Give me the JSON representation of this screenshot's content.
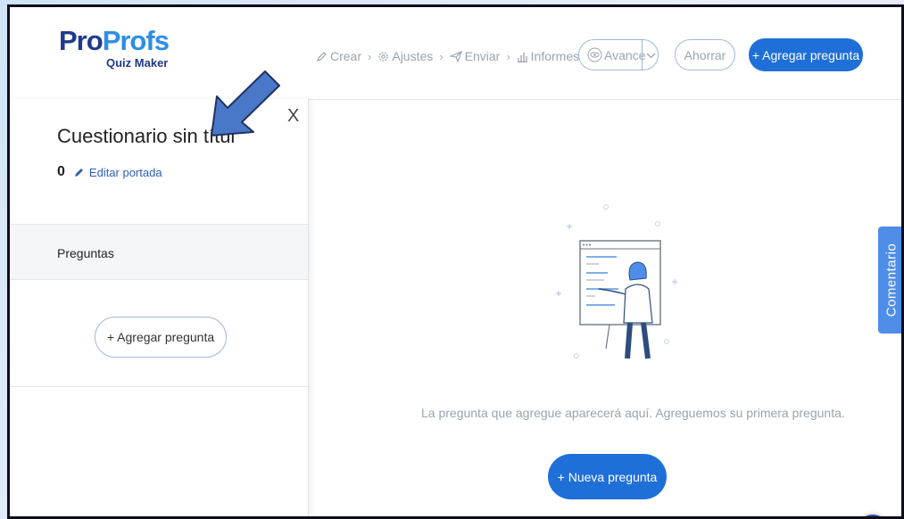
{
  "app": {
    "logo_main_1": "Pro",
    "logo_main_2": "Profs",
    "logo_sub": "Quiz Maker"
  },
  "steps": [
    {
      "label": "Crear",
      "icon": "pencil-icon"
    },
    {
      "label": "Ajustes",
      "icon": "gear-icon"
    },
    {
      "label": "Enviar",
      "icon": "paper-plane-icon"
    },
    {
      "label": "Informes",
      "icon": "bar-chart-icon"
    }
  ],
  "header": {
    "preview_label": "Avance",
    "save_label": "Ahorrar",
    "add_question_label": "+ Agregar pregunta"
  },
  "sidebar": {
    "close_label": "X",
    "quiz_title": "Cuestionario sin títul",
    "cover_count": "0",
    "edit_cover_label": "Editar portada",
    "section_label": "Preguntas",
    "add_question_label": "+ Agregar pregunta"
  },
  "main": {
    "empty_message": "La pregunta que agregue aparecerá aquí. Agreguemos su primera pregunta.",
    "new_question_label": "+ Nueva pregunta"
  },
  "feedback_tab_label": "Comentario",
  "colors": {
    "brand_dark": "#1f3a8c",
    "brand_light": "#2d8ee6",
    "primary_button": "#1f6fd8",
    "feedback_tab": "#4f8ee8",
    "annotation_arrow": "#4a78c8"
  }
}
